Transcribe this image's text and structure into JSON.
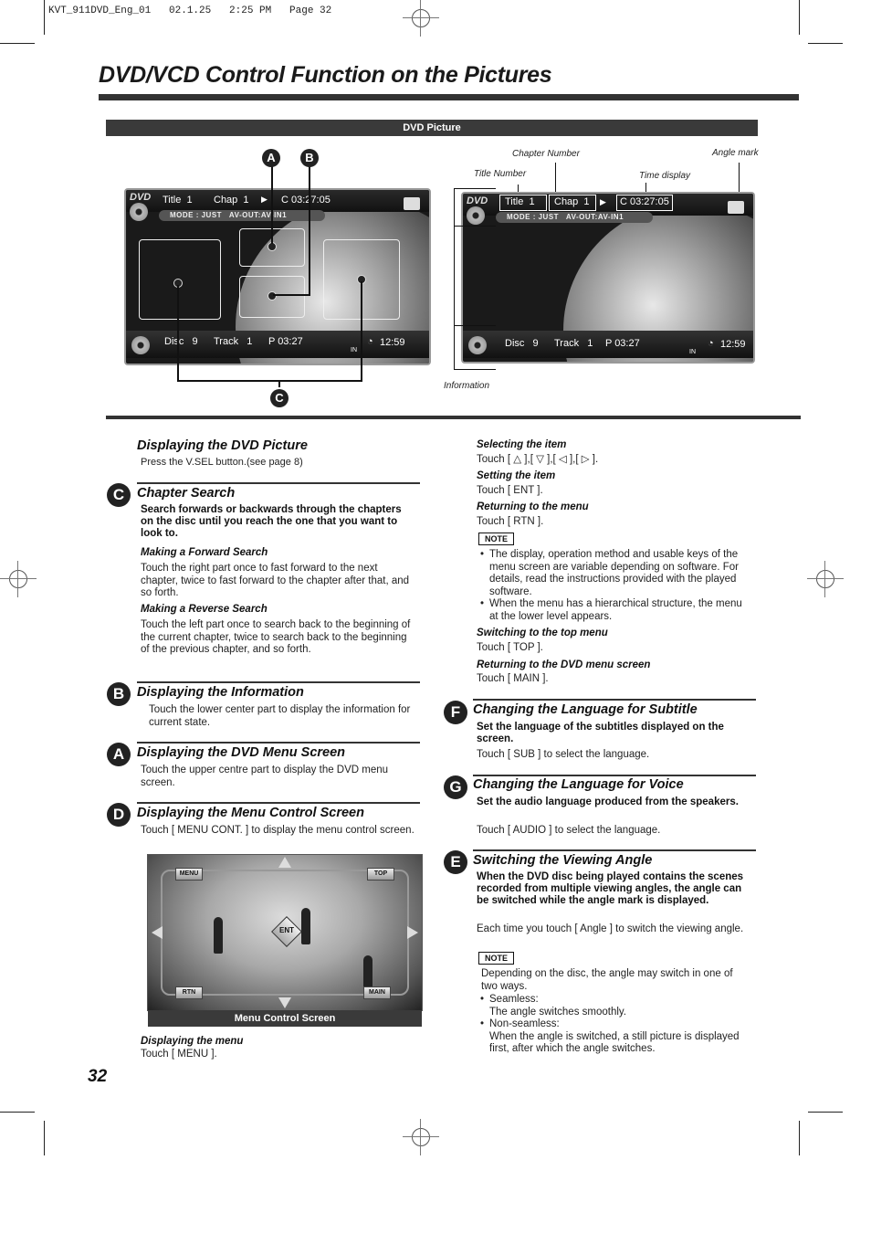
{
  "print_header": "KVT_911DVD_Eng_01   02.1.25   2:25 PM   Page 32",
  "page_title": "DVD/VCD Control Function on the Pictures",
  "figure_bar_label": "DVD Picture",
  "left_screen": {
    "dvd_logo": "DVD",
    "title_text": "Title  1",
    "chap_text": "Chap  1",
    "play_icon": "▶",
    "time_text": "C 03:27:05",
    "mode_text": "MODE : JUST   AV-OUT:AV-IN1",
    "disc_text": "Disc   9",
    "track_text": "Track   1",
    "p_time": "P 03:27",
    "in_label": "IN",
    "clock_icon": "◔",
    "clock_time": "12:59",
    "callouts": [
      "A",
      "B",
      "C"
    ]
  },
  "right_screen": {
    "dvd_logo": "DVD",
    "title_text": "Title  1",
    "chap_text": "Chap  1",
    "play_icon": "▶",
    "time_text": "C 03:27:05",
    "mode_text": "MODE : JUST   AV-OUT:AV-IN1",
    "disc_text": "Disc   9",
    "track_text": "Track   1",
    "p_time": "P 03:27",
    "in_label": "IN",
    "clock_icon": "◔",
    "clock_time": "12:59",
    "annotations": {
      "chapter_number": "Chapter Number",
      "angle_mark": "Angle mark",
      "title_number": "Title Number",
      "time_display": "Time  display",
      "information": "Information"
    }
  },
  "left_column": {
    "displaying_dvd_picture": {
      "heading": "Displaying the DVD Picture",
      "body": "Press the V.SEL button.(see page 8)"
    },
    "chapter_search": {
      "badge": "C",
      "heading": "Chapter Search",
      "lead": "Search forwards or backwards through the chapters on the disc until you reach the one that you want to look to.",
      "forward_heading": "Making a Forward Search",
      "forward_body": "Touch the right part once to fast forward to the next chapter, twice to fast forward to the chapter after that, and so forth.",
      "reverse_heading": "Making a Reverse Search",
      "reverse_body": "Touch the left part once to search back to the beginning of the current chapter, twice to search back to the beginning of the previous chapter, and so forth."
    },
    "displaying_information": {
      "badge": "B",
      "heading": "Displaying the Information",
      "body": "Touch the lower center part to display the information for current state."
    },
    "displaying_menu_screen": {
      "badge": "A",
      "heading": "Displaying the DVD Menu Screen",
      "body": "Touch the upper centre part to display the DVD menu screen."
    },
    "displaying_menu_control": {
      "badge": "D",
      "heading": "Displaying the Menu Control Screen",
      "body": "Touch [ MENU CONT. ] to display the menu control screen."
    },
    "menu_control_screen": {
      "buttons": {
        "menu": "MENU",
        "top": "TOP",
        "rtn": "RTN",
        "main": "MAIN",
        "ent": "ENT"
      },
      "caption": "Menu Control Screen"
    },
    "displaying_the_menu": {
      "heading": "Displaying the menu",
      "body": "Touch [ MENU ]."
    }
  },
  "right_column": {
    "selecting_item": {
      "heading": "Selecting the item",
      "body": "Touch [ △ ],[ ▽ ],[ ◁ ],[ ▷ ]."
    },
    "setting_item": {
      "heading": "Setting the item",
      "body": "Touch [ ENT ]."
    },
    "returning_menu": {
      "heading": "Returning to the menu",
      "body": "Touch [ RTN ]."
    },
    "note1": {
      "label": "NOTE",
      "bullets": [
        "The display, operation method and usable keys of the menu screen are variable depending on software. For details, read the instructions provided with the played software.",
        "When the menu has a hierarchical structure, the menu at the lower level appears."
      ]
    },
    "switching_top": {
      "heading": "Switching to the top menu",
      "body": "Touch [ TOP ]."
    },
    "returning_dvd_menu": {
      "heading": "Returning to the DVD menu screen",
      "body": "Touch [ MAIN ]."
    },
    "subtitle": {
      "badge": "F",
      "heading": "Changing the Language for Subtitle",
      "lead": "Set the language of the subtitles displayed on the screen.",
      "body": "Touch [ SUB ] to select the language."
    },
    "voice": {
      "badge": "G",
      "heading": "Changing the Language for Voice",
      "lead": "Set the audio language produced from the speakers.",
      "body": "Touch [ AUDIO ] to select the language."
    },
    "angle": {
      "badge": "E",
      "heading": "Switching the Viewing Angle",
      "lead": "When the DVD disc being played contains the scenes recorded from multiple viewing angles, the angle can be switched while the angle mark is displayed.",
      "body": "Each time you touch [ Angle ] to switch the viewing angle."
    },
    "note2": {
      "label": "NOTE",
      "intro": "Depending on the disc, the angle may switch in one of two ways.",
      "bullets": [
        {
          "term": "Seamless:",
          "desc": "The angle switches smoothly."
        },
        {
          "term": "Non-seamless:",
          "desc": "When the angle is switched, a still picture is displayed first, after which the angle switches."
        }
      ]
    }
  },
  "page_number": "32"
}
